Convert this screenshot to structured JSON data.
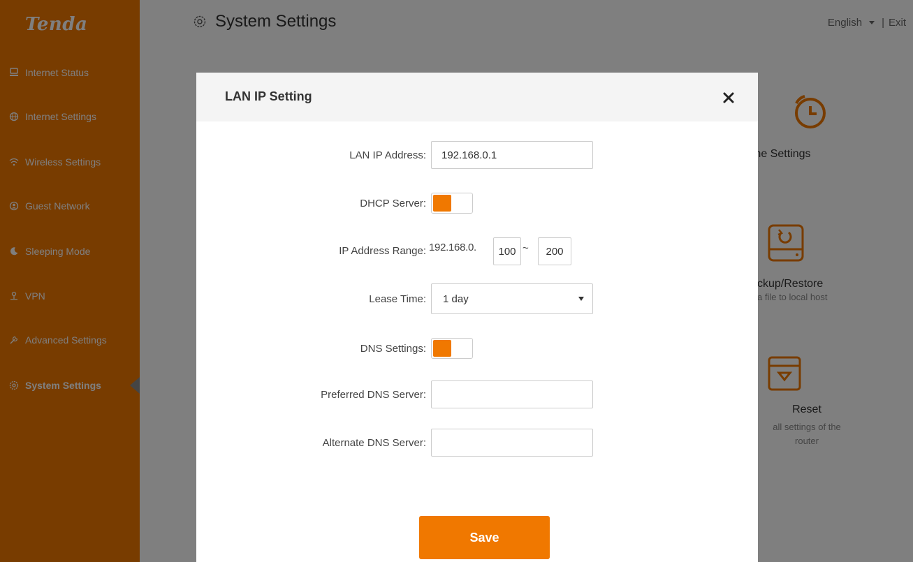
{
  "brand": {
    "logo": "Tenda",
    "accent": "#f07800"
  },
  "sidebar": {
    "items": [
      {
        "label": "Internet Status",
        "icon": "internet-status-icon",
        "active": false
      },
      {
        "label": "Internet Settings",
        "icon": "globe-icon",
        "active": false
      },
      {
        "label": "Wireless Settings",
        "icon": "wifi-icon",
        "active": false
      },
      {
        "label": "Guest Network",
        "icon": "guest-network-icon",
        "active": false
      },
      {
        "label": "Sleeping Mode",
        "icon": "moon-icon",
        "active": false
      },
      {
        "label": "VPN",
        "icon": "vpn-icon",
        "active": false
      },
      {
        "label": "Advanced Settings",
        "icon": "wrench-icon",
        "active": false
      },
      {
        "label": "System Settings",
        "icon": "gear-icon",
        "active": true
      }
    ]
  },
  "header": {
    "title": "System Settings",
    "language": "English",
    "separator": "|",
    "exit": "Exit"
  },
  "background_tiles": [
    {
      "title": "me Settings",
      "icon": "clock-icon"
    },
    {
      "title": "ckup/Restore",
      "desc": "a file to local host",
      "icon": "backup-restore-icon"
    },
    {
      "title": "Reset",
      "desc": "all settings of the",
      "desc2": "router",
      "icon": "reset-icon"
    }
  ],
  "modal": {
    "title": "LAN IP Setting",
    "close_icon": "close-icon",
    "fields": {
      "lan_ip_label": "LAN IP Address:",
      "lan_ip_value": "192.168.0.1",
      "dhcp_label": "DHCP Server:",
      "dhcp_enabled": true,
      "range_label": "IP Address Range:",
      "range_prefix": "192.168.0.",
      "range_start": "100",
      "range_separator": "~",
      "range_end": "200",
      "lease_label": "Lease Time:",
      "lease_value": "1 day",
      "dns_label": "DNS Settings:",
      "dns_enabled": true,
      "preferred_dns_label": "Preferred DNS Server:",
      "preferred_dns_value": "",
      "alternate_dns_label": "Alternate DNS Server:",
      "alternate_dns_value": ""
    },
    "save_label": "Save"
  }
}
